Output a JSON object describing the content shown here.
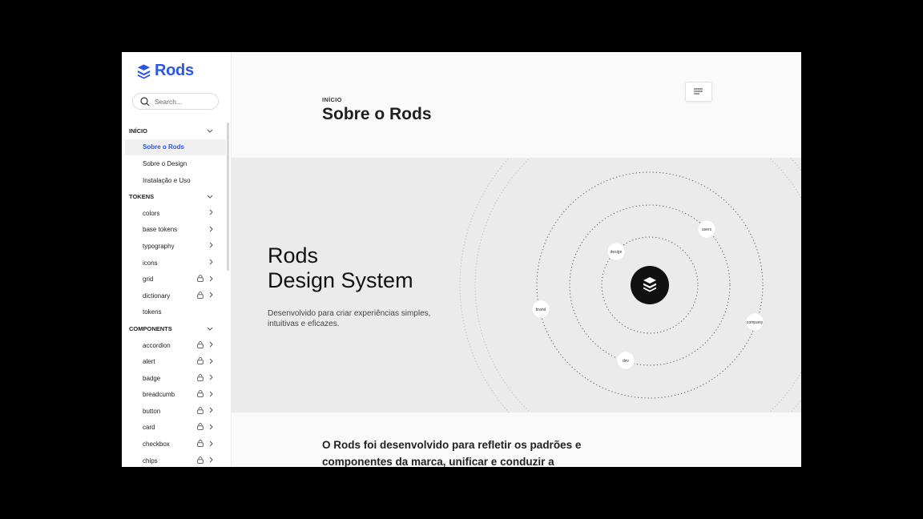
{
  "brand": {
    "name": "Rods",
    "accent": "#2a56e6"
  },
  "search": {
    "placeholder": "Search..."
  },
  "sidebar": {
    "sections": [
      {
        "title": "INÍCIO",
        "items": [
          {
            "label": "Sobre o Rods",
            "active": true,
            "locked": false,
            "chevron": false
          },
          {
            "label": "Sobre o Design",
            "active": false,
            "locked": false,
            "chevron": false
          },
          {
            "label": "Instalação e Uso",
            "active": false,
            "locked": false,
            "chevron": false
          }
        ]
      },
      {
        "title": "TOKENS",
        "items": [
          {
            "label": "colors",
            "locked": false,
            "chevron": true
          },
          {
            "label": "base tokens",
            "locked": false,
            "chevron": true
          },
          {
            "label": "typography",
            "locked": false,
            "chevron": true
          },
          {
            "label": "icons",
            "locked": false,
            "chevron": true
          },
          {
            "label": "grid",
            "locked": true,
            "chevron": true
          },
          {
            "label": "dictionary",
            "locked": true,
            "chevron": true
          },
          {
            "label": "tokens",
            "locked": false,
            "chevron": false
          }
        ]
      },
      {
        "title": "COMPONENTS",
        "items": [
          {
            "label": "accordion",
            "locked": true,
            "chevron": true
          },
          {
            "label": "alert",
            "locked": true,
            "chevron": true
          },
          {
            "label": "badge",
            "locked": true,
            "chevron": true
          },
          {
            "label": "breadcumb",
            "locked": true,
            "chevron": true
          },
          {
            "label": "button",
            "locked": true,
            "chevron": true
          },
          {
            "label": "card",
            "locked": true,
            "chevron": true
          },
          {
            "label": "checkbox",
            "locked": true,
            "chevron": true
          },
          {
            "label": "chips",
            "locked": true,
            "chevron": true
          }
        ]
      }
    ]
  },
  "header": {
    "eyebrow": "INÍCIO",
    "title": "Sobre o Rods"
  },
  "hero": {
    "title_line1": "Rods",
    "title_line2": "Design System",
    "subtitle": "Desenvolvido para criar experiências simples, intuitivas e eficazes.",
    "orbit_labels": [
      "users",
      "design",
      "brand",
      "company",
      "dev"
    ]
  },
  "intro": {
    "text": "O Rods foi desenvolvido para refletir os padrões e componentes da marca, unificar e conduzir a"
  }
}
